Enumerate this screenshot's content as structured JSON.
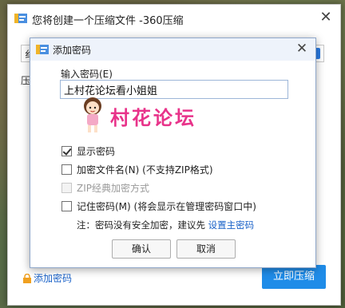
{
  "main_window": {
    "title": "您将创建一个压缩文件 -360压缩",
    "field_partial": "纟",
    "label_partial": "压",
    "add_password_link": "添加密码",
    "compress_button": "立即压缩"
  },
  "dialog": {
    "title": "添加密码",
    "password_label": "输入密码(E)",
    "password_value": "上村花论坛看小姐姐",
    "options": [
      {
        "label": "显示密码",
        "checked": true,
        "enabled": true
      },
      {
        "label": "加密文件名(N) (不支持ZIP格式)",
        "checked": false,
        "enabled": true
      },
      {
        "label": "ZIP经典加密方式",
        "checked": false,
        "enabled": false
      },
      {
        "label": "记住密码(M) (将会显示在管理密码窗口中)",
        "checked": false,
        "enabled": true
      }
    ],
    "note_prefix": "注：密码没有安全加密，建议先 ",
    "note_link": "设置主密码",
    "ok_button": "确认",
    "cancel_button": "取消"
  },
  "watermark": {
    "text": "村花论坛"
  },
  "colors": {
    "link_blue": "#1a62c8",
    "primary_button": "#1f8ce8",
    "watermark_pink": "#e8338a"
  }
}
